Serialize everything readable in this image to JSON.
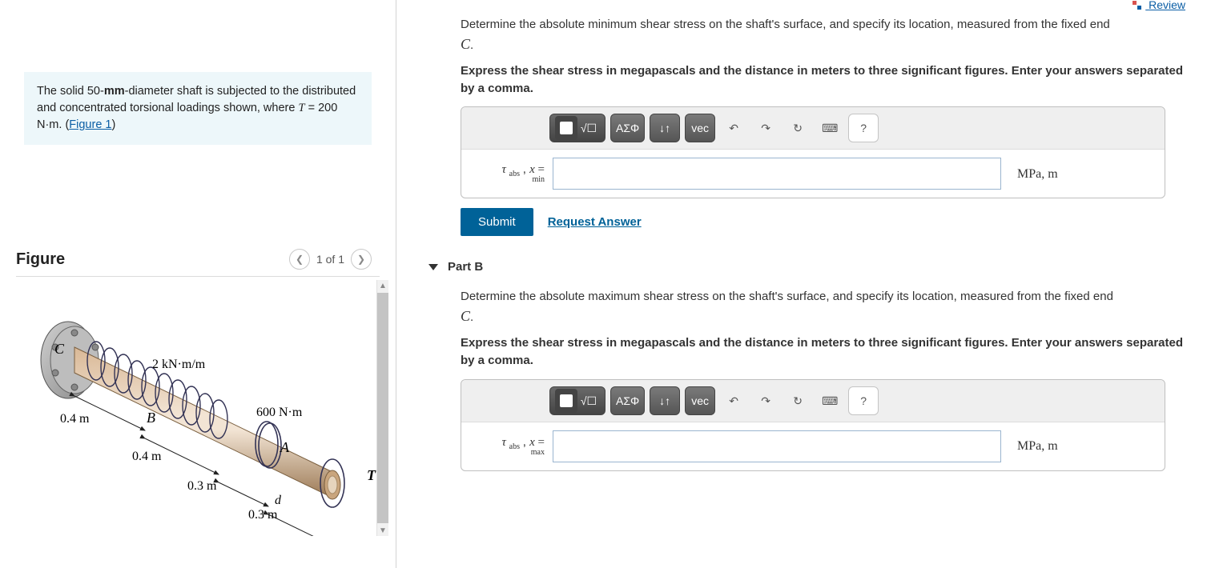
{
  "left": {
    "statement_prefix": "The solid 50-",
    "statement_unit": "mm",
    "statement_mid": "-diameter shaft is subjected to the distributed and concentrated torsional loadings shown, where ",
    "statement_var": "T",
    "statement_eq": " = 200 N·m",
    "statement_suffix": ". (",
    "figure_link": "Figure 1",
    "statement_close": ")",
    "figure_title": "Figure",
    "pager_text": "1 of 1",
    "figure_labels": {
      "C": "C",
      "B": "B",
      "A": "A",
      "d": "d",
      "T": "T",
      "dist_load": "2 kN·m/m",
      "conc_torque": "600 N·m",
      "len1": "0.4 m",
      "len2": "0.4 m",
      "len3": "0.3 m",
      "len4": "0.3 m"
    }
  },
  "right": {
    "review": "Review",
    "partA": {
      "question": "Determine the absolute minimum shear stress on the shaft's surface, and specify its location, measured from the fixed end ",
      "question_var": "C",
      "question_end": ".",
      "instruction": "Express the shear stress in megapascals and the distance in meters to three significant figures. Enter your answers separated by a comma.",
      "var_tau": "τ",
      "var_sub": "abs",
      "var_sub2": "min",
      "var_x": "x",
      "eq": " =",
      "unit": "MPa, m",
      "submit": "Submit",
      "request": "Request Answer"
    },
    "partB": {
      "header": "Part B",
      "question": "Determine the absolute maximum shear stress on the shaft's surface, and specify its location, measured from the fixed end ",
      "question_var": "C",
      "question_end": ".",
      "instruction": "Express the shear stress in megapascals and the distance in meters to three significant figures. Enter your answers separated by a comma.",
      "var_tau": "τ",
      "var_sub": "abs",
      "var_sub2": "max",
      "var_x": "x",
      "eq": " =",
      "unit": "MPa, m"
    },
    "toolbar": {
      "greek": "ΑΣΦ",
      "vec": "vec",
      "help": "?"
    }
  }
}
